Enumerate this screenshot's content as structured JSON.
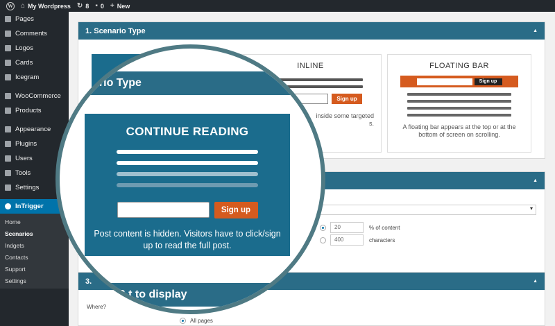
{
  "admin_bar": {
    "site_name": "My Wordpress",
    "updates_count": "8",
    "comments_count": "0",
    "new_label": "New"
  },
  "sidebar": {
    "items": [
      {
        "label": "Pages"
      },
      {
        "label": "Comments"
      },
      {
        "label": "Logos"
      },
      {
        "label": "Cards"
      },
      {
        "label": "Icegram"
      },
      {
        "label": "WooCommerce"
      },
      {
        "label": "Products"
      },
      {
        "label": "Appearance"
      },
      {
        "label": "Plugins"
      },
      {
        "label": "Users"
      },
      {
        "label": "Tools"
      },
      {
        "label": "Settings"
      },
      {
        "label": "InTrigger"
      }
    ],
    "submenu": [
      {
        "label": "Home"
      },
      {
        "label": "Scenarios"
      },
      {
        "label": "Indgets"
      },
      {
        "label": "Contacts"
      },
      {
        "label": "Support"
      },
      {
        "label": "Settings"
      }
    ]
  },
  "section1": {
    "title": "1. Scenario Type",
    "cards": {
      "inline": {
        "title": "INLINE",
        "signup": "Sign up",
        "desc_partial": "inside some targeted",
        "desc_partial2": "s."
      },
      "floating": {
        "title": "FLOATING BAR",
        "signup": "Sign up",
        "desc": "A floating bar appears at the top or at the bottom of screen on scrolling."
      },
      "continue": {
        "title_partial": "CO"
      }
    }
  },
  "magnifier": {
    "title": "ario Type",
    "card_title": "CONTINUE READING",
    "signup": "Sign up",
    "desc": "Post content is hidden. Visitors have to click/sign up to read the full post.",
    "section3_title": "S    t to display"
  },
  "section2": {
    "opt1_value": "20",
    "opt1_suffix": "% of content",
    "opt2_value": "400",
    "opt2_suffix": "characters"
  },
  "section3": {
    "title_prefix": "3.",
    "where_label": "Where?",
    "all_pages": "All pages"
  },
  "colors": {
    "header": "#2a6c87",
    "accent": "#d55b1f",
    "admin": "#23282d",
    "active": "#0073aa"
  }
}
